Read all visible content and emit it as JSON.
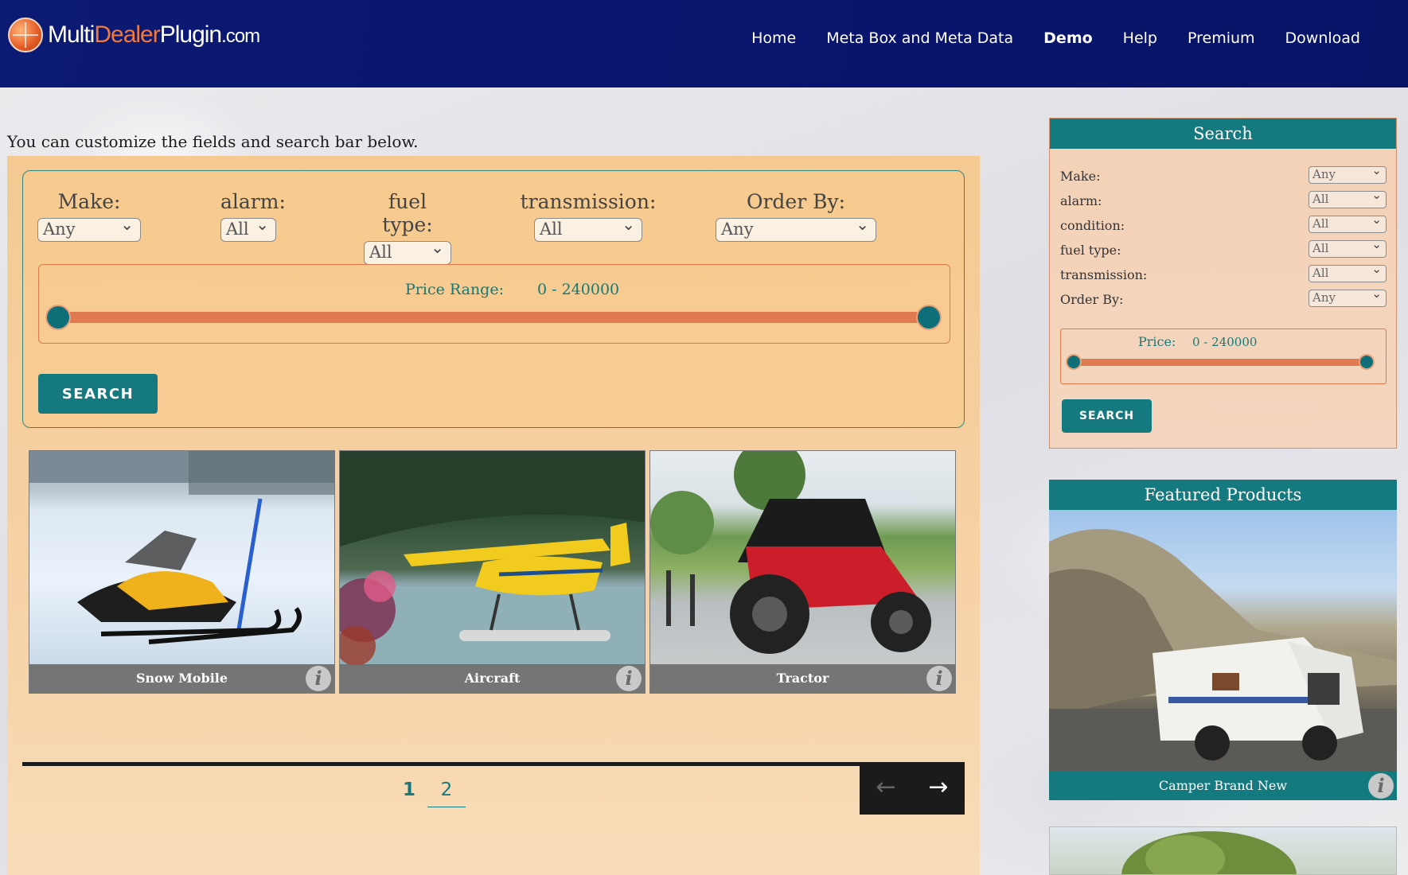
{
  "header": {
    "logo": {
      "part1": "Multi",
      "part2": "Dealer",
      "part3": "Plugin",
      "part4": ".com"
    },
    "nav": [
      {
        "label": "Home"
      },
      {
        "label": "Meta Box and Meta Data"
      },
      {
        "label": "Demo"
      },
      {
        "label": "Help"
      },
      {
        "label": "Premium"
      },
      {
        "label": "Download"
      }
    ]
  },
  "main": {
    "intro": "You can customize the fields and search bar below.",
    "filters": [
      {
        "label": "Make:",
        "value": "Any"
      },
      {
        "label": "alarm:",
        "value": "All"
      },
      {
        "label": "fuel type:",
        "value": "All"
      },
      {
        "label": "transmission:",
        "value": "All"
      },
      {
        "label": "Order By:",
        "value": "Any"
      }
    ],
    "price": {
      "label": "Price Range:",
      "value": "0 - 240000"
    },
    "search_label": "SEARCH",
    "products": [
      {
        "name": "Snow Mobile"
      },
      {
        "name": "Aircraft"
      },
      {
        "name": "Tractor"
      }
    ],
    "pagination": {
      "pages": [
        "1",
        "2"
      ],
      "current": "1",
      "prev": "←",
      "next": "→"
    }
  },
  "sidebar": {
    "search": {
      "title": "Search",
      "fields": [
        {
          "label": "Make:",
          "value": "Any"
        },
        {
          "label": "alarm:",
          "value": "All"
        },
        {
          "label": "condition:",
          "value": "All"
        },
        {
          "label": "fuel type:",
          "value": "All"
        },
        {
          "label": "transmission:",
          "value": "All"
        },
        {
          "label": "Order By:",
          "value": "Any"
        }
      ],
      "price_label": "Price:",
      "price_value": "0 - 240000",
      "button": "SEARCH"
    },
    "featured": {
      "title": "Featured Products",
      "items": [
        {
          "name": "Camper Brand New"
        }
      ]
    }
  },
  "icons": {
    "info": "i"
  }
}
